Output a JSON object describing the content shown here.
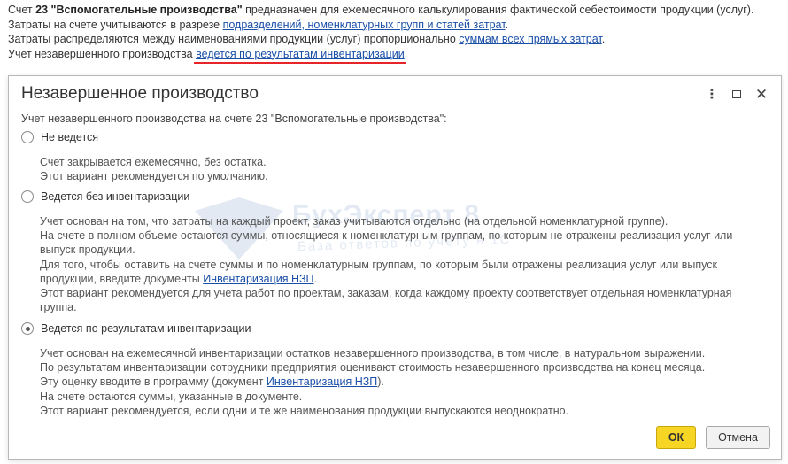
{
  "intro": {
    "line1_pre": "Счет ",
    "line1_bold": "23 \"Вспомогательные производства\"",
    "line1_post": " предназначен для ежемесячного калькулирования фактической себестоимости продукции (услуг).",
    "line2_pre": "Затраты на счете учитываются в разрезе ",
    "line2_link": "подразделений, номенклатурных групп и статей затрат",
    "line2_post": ".",
    "line3_pre": "Затраты распределяются между наименованиями продукции (услуг) пропорционально ",
    "line3_link": "суммам всех прямых затрат",
    "line3_post": ".",
    "line4_pre": "Учет незавершенного производства ",
    "line4_link": "ведется по результатам инвентаризации",
    "line4_post": "."
  },
  "dialog": {
    "title": "Незавершенное производство",
    "heading": "Учет незавершенного производства на счете 23 \"Вспомогательные производства\":",
    "options": [
      {
        "label": "Не ведется",
        "checked": false,
        "desc": [
          "Счет закрывается ежемесячно, без остатка.",
          "Этот вариант рекомендуется по умолчанию."
        ]
      },
      {
        "label": "Ведется без инвентаризации",
        "checked": false,
        "desc": [
          "Учет основан на том, что затраты на каждый проект, заказ учитываются отдельно (на отдельной номенклатурной группе).",
          "На счете в полном объеме остаются суммы, относящиеся к номенклатурным группам, по которым не отражены реализация услуг или",
          "выпуск продукции.",
          "Для того, чтобы оставить на счете суммы и по номенклатурным группам, по которым были отражены реализация услуг или выпуск",
          "продукции, введите документы ",
          "Этот вариант рекомендуется для учета работ по проектам, заказам, когда каждому проекту соответствует отдельная номенклатурная",
          "группа."
        ],
        "doc_link": "Инвентаризация НЗП",
        "doc_link_post": "."
      },
      {
        "label": "Ведется по результатам инвентаризации",
        "checked": true,
        "desc": [
          "Учет основан на ежемесячной инвентаризации остатков незавершенного производства, в том числе, в натуральном выражении.",
          "По результатам инвентаризации сотрудники предприятия оценивают стоимость незавершенного производства на конец месяца.",
          "Эту оценку вводите в программу (документ ",
          "На счете остаются суммы, указанные в документе.",
          "Этот вариант рекомендуется, если одни и те же наименования продукции выпускаются неоднократно."
        ],
        "doc_link": "Инвентаризация НЗП",
        "doc_link_post": ")."
      }
    ],
    "ok_label": "ОК",
    "cancel_label": "Отмена"
  },
  "watermark": {
    "title": "БухЭксперт 8",
    "subtitle": "База ответов по учёту в 1С"
  },
  "icons": {
    "menu": "more-vertical-icon",
    "maximize": "maximize-icon",
    "close": "close-icon"
  },
  "colors": {
    "link": "#1a4fa8",
    "ok_button": "#f7d524",
    "highlight_underline": "#e8242b"
  }
}
